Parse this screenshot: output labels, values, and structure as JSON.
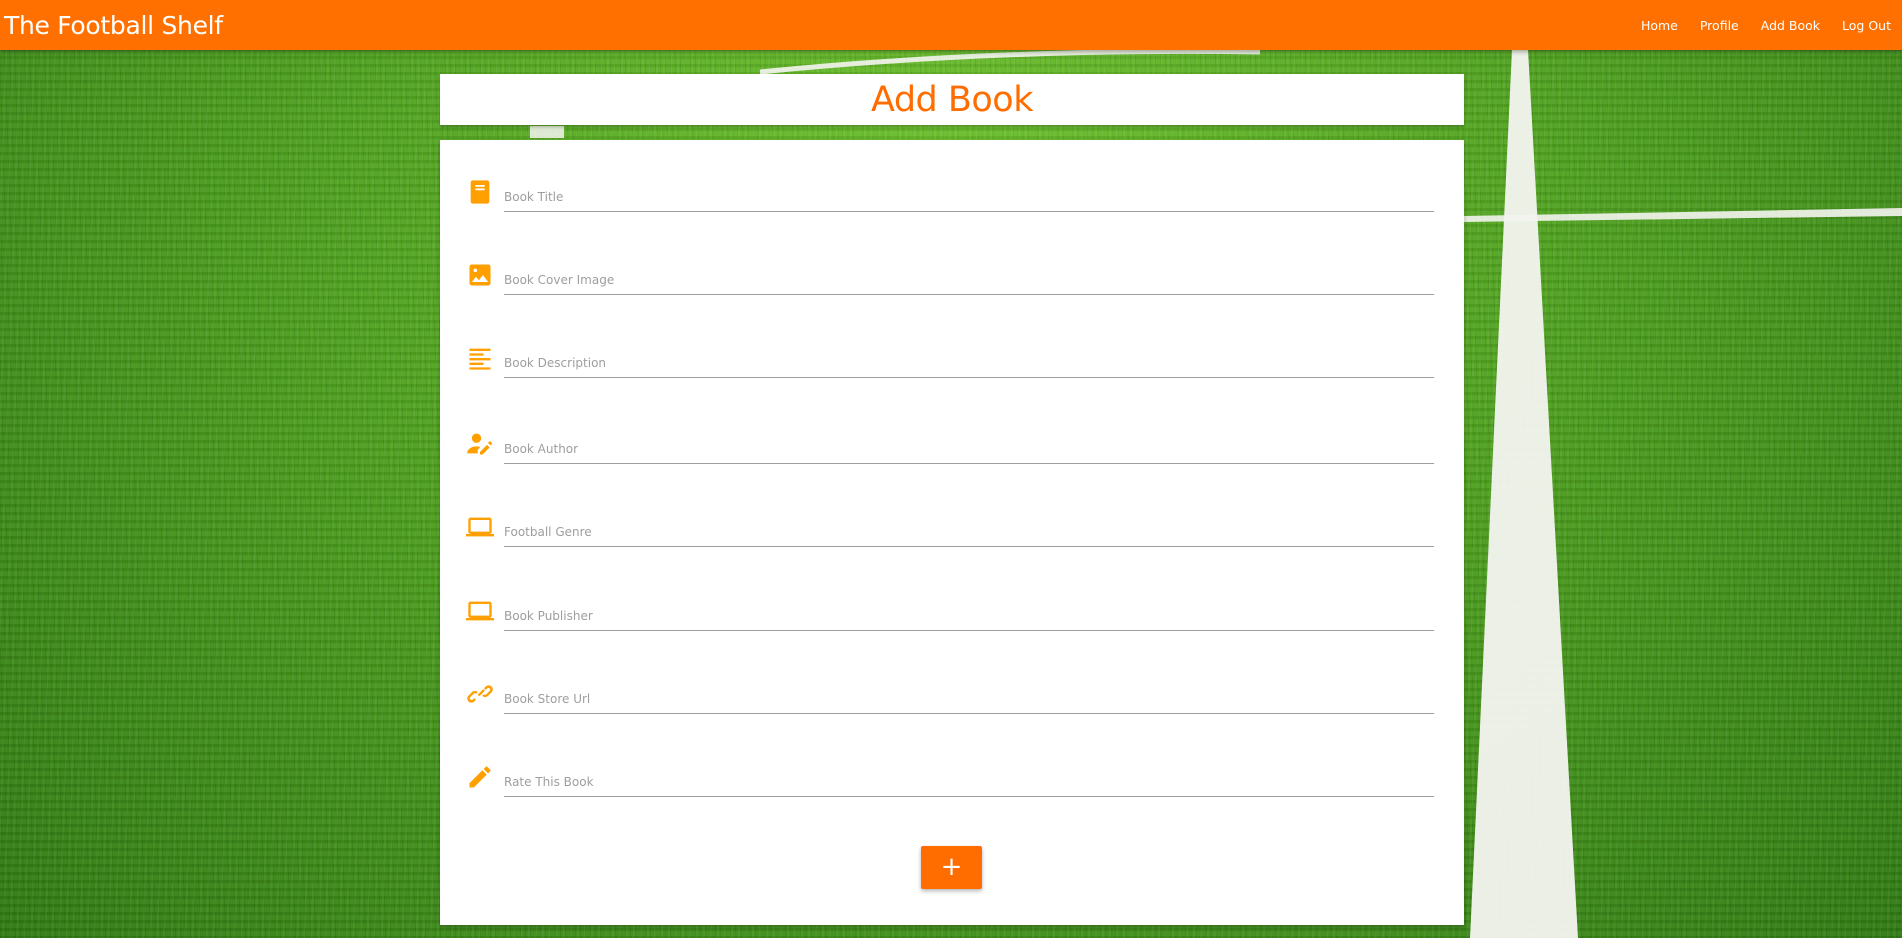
{
  "navbar": {
    "brand": "The Football Shelf",
    "links": [
      "Home",
      "Profile",
      "Add Book",
      "Log Out"
    ]
  },
  "page": {
    "title": "Add Book"
  },
  "form": {
    "fields": [
      {
        "placeholder": "Book Title",
        "icon": "book-icon"
      },
      {
        "placeholder": "Book Cover Image",
        "icon": "image-icon"
      },
      {
        "placeholder": "Book Description",
        "icon": "text-lines-icon"
      },
      {
        "placeholder": "Book Author",
        "icon": "person-edit-icon"
      },
      {
        "placeholder": "Football Genre",
        "icon": "laptop-icon"
      },
      {
        "placeholder": "Book Publisher",
        "icon": "laptop-icon"
      },
      {
        "placeholder": "Book Store Url",
        "icon": "link-icon"
      },
      {
        "placeholder": "Rate This Book",
        "icon": "pencil-icon"
      }
    ],
    "submit_label": "+"
  },
  "colors": {
    "navbar": "#ff7000",
    "title_text": "#ff6d00",
    "icons": "#ff9f00",
    "button": "#ff6d00",
    "background": "grass-green"
  }
}
